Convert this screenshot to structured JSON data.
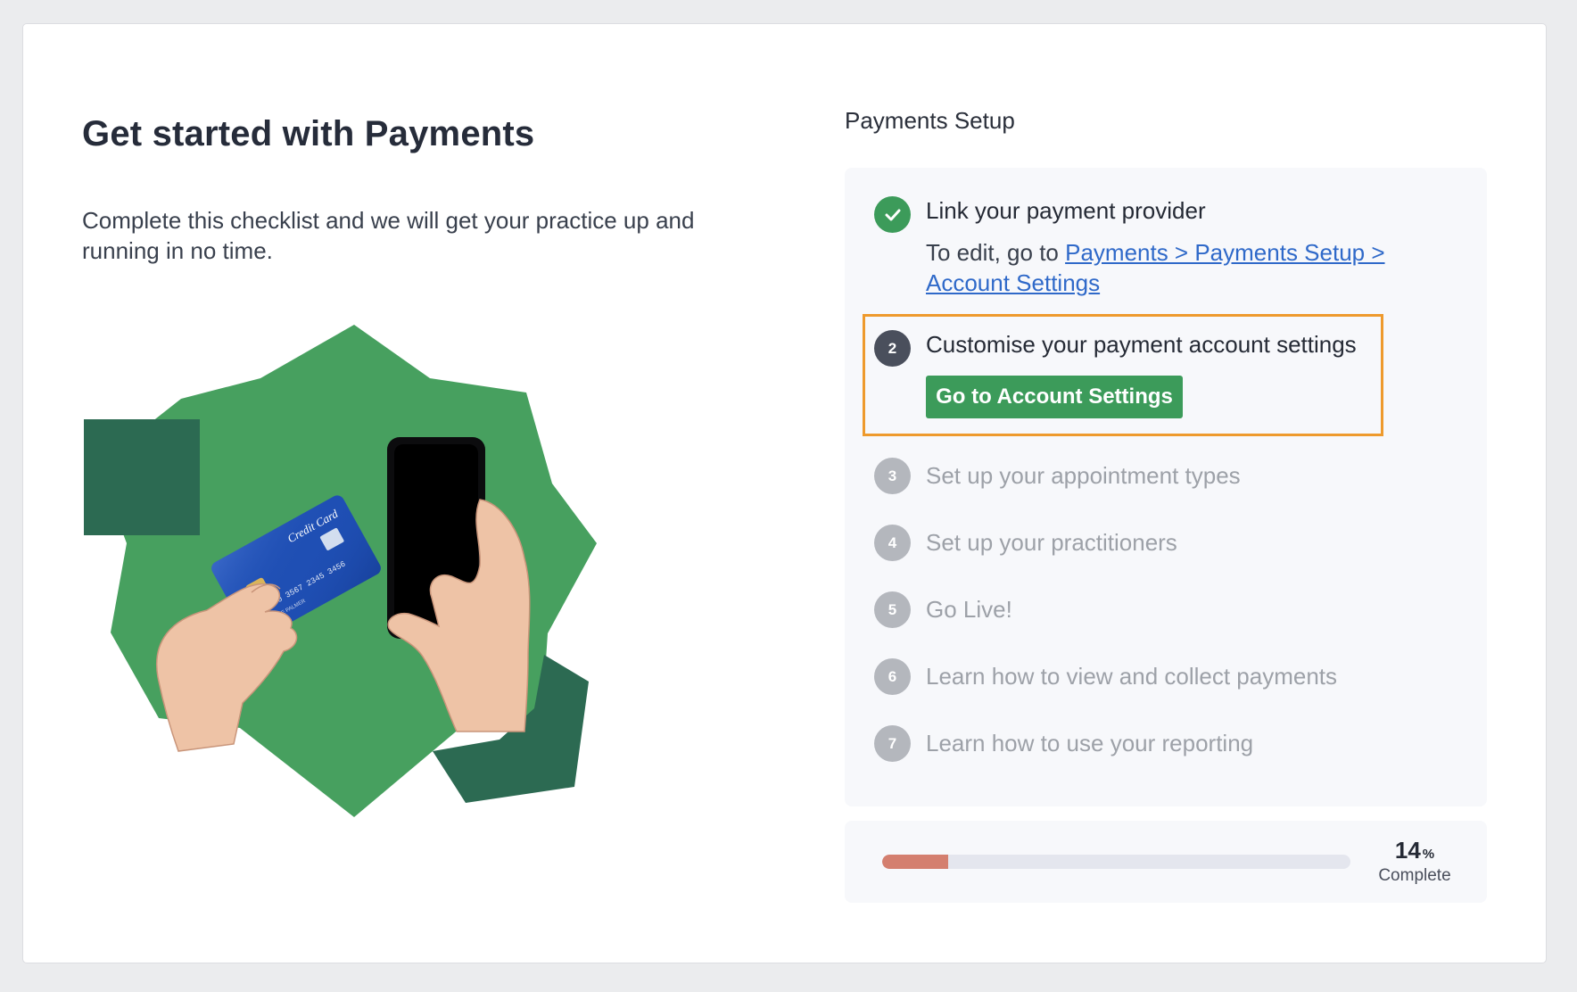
{
  "intro": {
    "title": "Get started with Payments",
    "description": "Complete this checklist and we will get your practice up and running in no time."
  },
  "illustration": {
    "card_text": "Credit Card",
    "card_number": "5890 3567 2345 3456",
    "card_holder": "NAME PALMER",
    "colors": {
      "green": "#47a05f",
      "dark_green": "#2c6a52",
      "card_blue": "#1f4fb4"
    }
  },
  "setup": {
    "heading": "Payments Setup",
    "steps": [
      {
        "number": "1",
        "status": "done",
        "label": "Link your payment provider",
        "sub_prefix": "To edit, go to ",
        "sub_link": "Payments > Payments Setup > Account Settings"
      },
      {
        "number": "2",
        "status": "active",
        "label": "Customise your payment account settings",
        "button_label": "Go to Account Settings"
      },
      {
        "number": "3",
        "status": "pending",
        "label": "Set up your appointment types"
      },
      {
        "number": "4",
        "status": "pending",
        "label": "Set up your practitioners"
      },
      {
        "number": "5",
        "status": "pending",
        "label": "Go Live!"
      },
      {
        "number": "6",
        "status": "pending",
        "label": "Learn how to view and collect payments"
      },
      {
        "number": "7",
        "status": "pending",
        "label": "Learn how to use your reporting"
      }
    ]
  },
  "progress": {
    "value": 14,
    "unit": "%",
    "label": "Complete"
  },
  "colors": {
    "accent_green": "#3c9b5a",
    "highlight_orange": "#ee9a2d",
    "progress_fill": "#d47f6f",
    "link_blue": "#2f69c9"
  }
}
